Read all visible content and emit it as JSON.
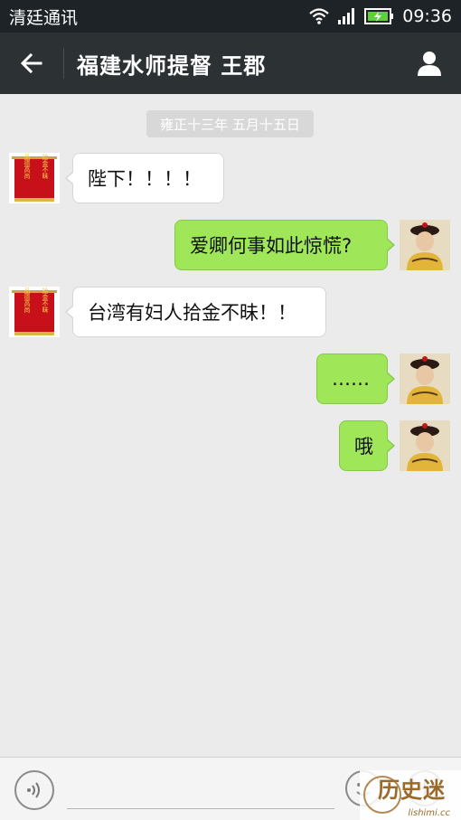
{
  "status_bar": {
    "carrier": "清廷通讯",
    "time": "09:36",
    "icons": [
      "wifi-icon",
      "signal-icon",
      "battery-charging-icon"
    ]
  },
  "header": {
    "title": "福建水师提督 王郡",
    "back_icon": "arrow-left-icon",
    "profile_icon": "person-icon"
  },
  "chat": {
    "date_label": "雍正十三年 五月十五日",
    "messages": [
      {
        "side": "incoming",
        "text": "陛下！！！！",
        "avatar": "banner-avatar"
      },
      {
        "side": "outgoing",
        "text": "爱卿何事如此惊慌?",
        "avatar": "emperor-portrait-avatar"
      },
      {
        "side": "incoming",
        "text": "台湾有妇人拾金不昧！！",
        "avatar": "banner-avatar"
      },
      {
        "side": "outgoing",
        "text": "……",
        "avatar": "emperor-portrait-avatar"
      },
      {
        "side": "outgoing",
        "text": "哦",
        "avatar": "emperor-portrait-avatar"
      }
    ]
  },
  "banner_avatar": {
    "col_right": "拾金不昧",
    "col_left": "品德高尚"
  },
  "input_bar": {
    "voice_icon": "voice-icon",
    "emoji_icon": "emoji-icon",
    "more_icon": "plus-icon"
  },
  "watermark": {
    "text": "历史迷",
    "sub": "lishimi.cc"
  },
  "colors": {
    "status_bar": "#1e2327",
    "app_bar": "#2c3134",
    "background": "#ebebeb",
    "outgoing_bubble": "#9fe659",
    "incoming_bubble": "#ffffff"
  }
}
